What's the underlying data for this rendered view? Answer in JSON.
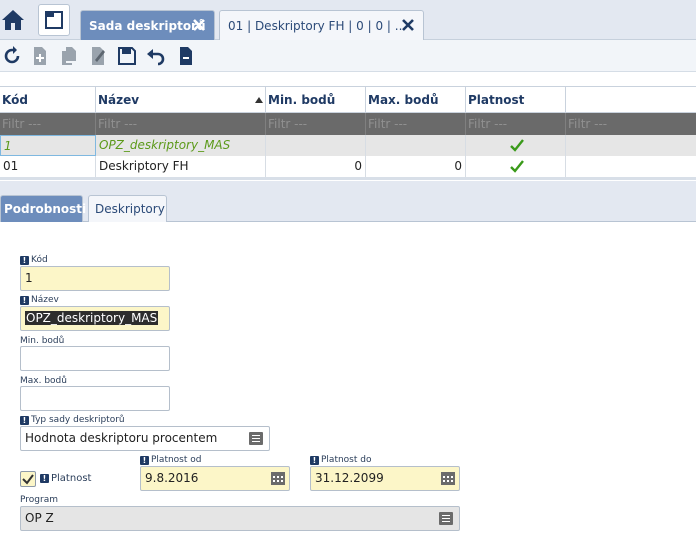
{
  "tabs": {
    "active_label": "Sada deskriptorů",
    "second_label": "01 | Deskriptory FH | 0 | 0 | ..."
  },
  "grid": {
    "columns": [
      "Kód",
      "Název",
      "Min. bodů",
      "Max. bodů",
      "Platnost"
    ],
    "filter_placeholder": "Filtr ---",
    "rows": [
      {
        "kod": "1",
        "nazev": "OPZ_deskriptory_MAS",
        "min": "",
        "max": "",
        "platnost": true
      },
      {
        "kod": "01",
        "nazev": "Deskriptory FH",
        "min": "0",
        "max": "0",
        "platnost": true
      }
    ]
  },
  "detail_tabs": [
    "Podrobnosti",
    "Deskriptory"
  ],
  "form": {
    "kod_label": "Kód",
    "kod_value": "1",
    "nazev_label": "Název",
    "nazev_value": "OPZ_deskriptory_MAS",
    "min_label": "Min. bodů",
    "min_value": "",
    "max_label": "Max. bodů",
    "max_value": "",
    "typ_label": "Typ sady deskriptorů",
    "typ_value": "Hodnota deskriptoru procentem",
    "platnost_label": "Platnost",
    "platnost_checked": true,
    "platnost_od_label": "Platnost od",
    "platnost_od_value": "9.8.2016",
    "platnost_do_label": "Platnost do",
    "platnost_do_value": "31.12.2099",
    "program_label": "Program",
    "program_value": "OP Z"
  },
  "colors": {
    "accent": "#6d8dbc",
    "required_field": "#fcf6c8",
    "check_green": "#3a9a1a",
    "header_text": "#1f3a64"
  },
  "icons": [
    "home-icon",
    "document-icon",
    "refresh-icon",
    "add-icon",
    "copy-icon",
    "edit-icon",
    "save-icon",
    "undo-icon",
    "remove-icon",
    "close-icon",
    "check-icon",
    "list-picker-icon",
    "calendar-icon"
  ]
}
